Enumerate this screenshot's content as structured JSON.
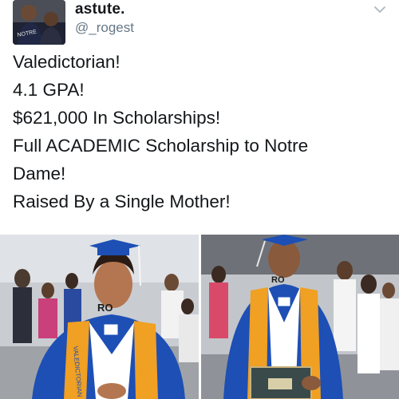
{
  "tweet": {
    "display_name": "astute.",
    "handle": "@_rogest",
    "lines": [
      "Valedictorian!",
      "4.1 GPA!",
      "$621,000 In Scholarships!",
      "Full ACADEMIC Scholarship to Notre",
      "Dame!",
      "Raised By a Single Mother!"
    ]
  },
  "photos": {
    "left": {
      "stole_text": "VALEDICTORIAN",
      "cap_text": "RO"
    },
    "right": {
      "cap_text": "RO"
    }
  },
  "icons": [
    "avatar",
    "chevron-down-icon"
  ],
  "colors": {
    "gown_blue": "#1d4fb5",
    "stole_gold": "#f0a023",
    "text": "#14171a",
    "handle": "#657786"
  }
}
